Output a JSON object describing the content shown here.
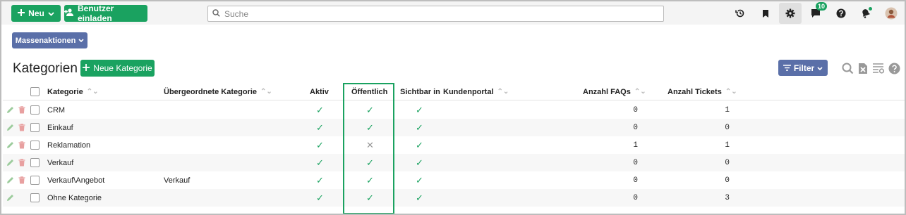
{
  "colors": {
    "primary": "#1aa260",
    "secondary": "#5a6fa8",
    "highlight": "#1aa260"
  },
  "topbar": {
    "new_label": "Neu",
    "invite_label": "Benutzer einladen",
    "search_placeholder": "Suche",
    "chat_badge": "10",
    "icons": [
      "history-icon",
      "bookmark-icon",
      "settings-icon",
      "chat-icon",
      "help-icon",
      "notification-icon",
      "avatar"
    ]
  },
  "mass_actions_label": "Massenaktionen",
  "page": {
    "title": "Kategorien",
    "new_category_label": "Neue Kategorie",
    "filter_label": "Filter"
  },
  "table": {
    "headers": {
      "kategorie": "Kategorie",
      "uebergeordnet": "Übergeordnete Kategorie",
      "aktiv": "Aktiv",
      "oeffentlich": "Öffentlich",
      "sichtbar": "Sichtbar in",
      "kundenportal": "Kundenportal",
      "faqs": "Anzahl FAQs",
      "tickets": "Anzahl Tickets"
    },
    "rows": [
      {
        "kategorie": "CRM",
        "uebergeordnet": "",
        "aktiv": true,
        "oeffentlich": true,
        "sichtbar": true,
        "faqs": "0",
        "tickets": "1",
        "deletable": true
      },
      {
        "kategorie": "Einkauf",
        "uebergeordnet": "",
        "aktiv": true,
        "oeffentlich": true,
        "sichtbar": true,
        "faqs": "0",
        "tickets": "0",
        "deletable": true
      },
      {
        "kategorie": "Reklamation",
        "uebergeordnet": "",
        "aktiv": true,
        "oeffentlich": false,
        "sichtbar": true,
        "faqs": "1",
        "tickets": "1",
        "deletable": true
      },
      {
        "kategorie": "Verkauf",
        "uebergeordnet": "",
        "aktiv": true,
        "oeffentlich": true,
        "sichtbar": true,
        "faqs": "0",
        "tickets": "0",
        "deletable": true
      },
      {
        "kategorie": "Verkauf\\Angebot",
        "uebergeordnet": "Verkauf",
        "aktiv": true,
        "oeffentlich": true,
        "sichtbar": true,
        "faqs": "0",
        "tickets": "0",
        "deletable": true
      },
      {
        "kategorie": "Ohne Kategorie",
        "uebergeordnet": "",
        "aktiv": true,
        "oeffentlich": true,
        "sichtbar": true,
        "faqs": "0",
        "tickets": "3",
        "deletable": false
      }
    ]
  }
}
